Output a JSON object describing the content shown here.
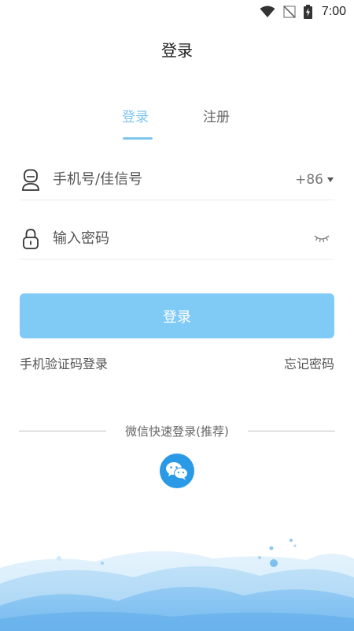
{
  "status_bar": {
    "time": "7:00",
    "icons": [
      "wifi-icon",
      "no-signal-icon",
      "battery-charging-icon"
    ]
  },
  "header": {
    "title": "登录"
  },
  "tabs": [
    {
      "label": "登录",
      "active": true
    },
    {
      "label": "注册",
      "active": false
    }
  ],
  "form": {
    "phone": {
      "placeholder": "手机号/佳信号",
      "value": "",
      "country_code": "+86"
    },
    "password": {
      "placeholder": "输入密码",
      "value": ""
    }
  },
  "login_button": {
    "label": "登录"
  },
  "links": {
    "sms_login": "手机验证码登录",
    "forgot_password": "忘记密码"
  },
  "third_party": {
    "divider_text": "微信快速登录(推荐)",
    "icon": "wechat-icon"
  },
  "colors": {
    "accent": "#7ec6ee",
    "button": "#80caf6",
    "wechat": "#2a9ae6"
  }
}
